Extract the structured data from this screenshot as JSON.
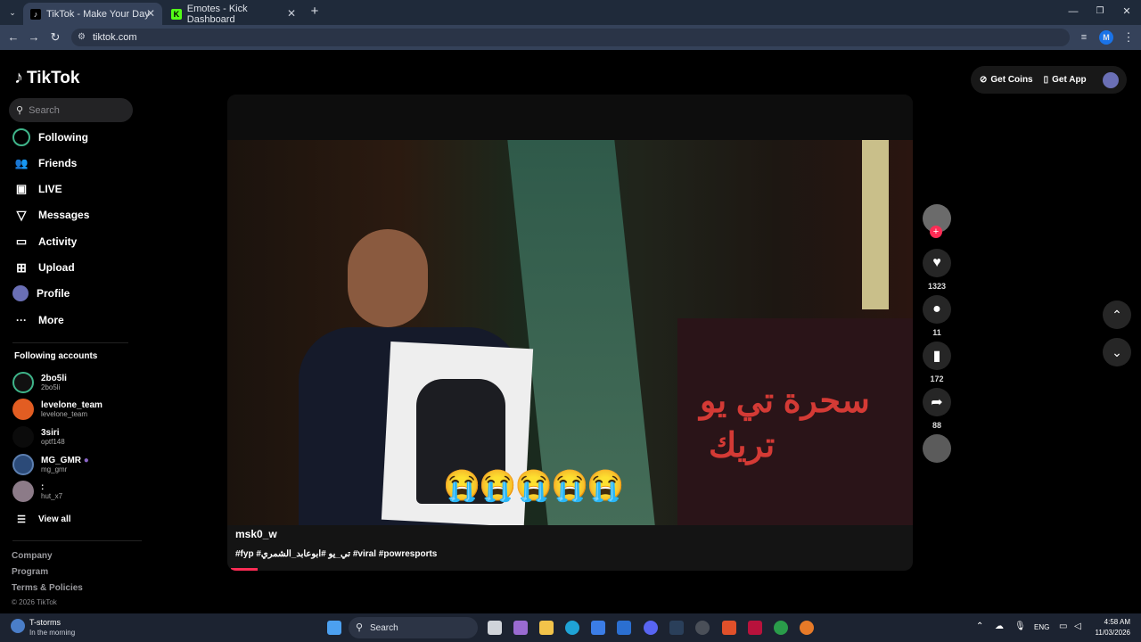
{
  "browser": {
    "tabs": [
      {
        "title": "TikTok - Make Your Day",
        "active": true
      },
      {
        "title": "Emotes - Kick Dashboard",
        "active": false
      }
    ],
    "url": "tiktok.com",
    "profile_initial": "M"
  },
  "app": {
    "brand": "TikTok",
    "search_placeholder": "Search",
    "nav": {
      "following": "Following",
      "friends": "Friends",
      "live": "LIVE",
      "messages": "Messages",
      "activity": "Activity",
      "upload": "Upload",
      "profile": "Profile",
      "more": "More"
    },
    "following_title": "Following accounts",
    "accounts": [
      {
        "name": "2bo5li",
        "handle": "2bo5li"
      },
      {
        "name": "levelone_team",
        "handle": "levelone_team"
      },
      {
        "name": "3siri",
        "handle": "optf148"
      },
      {
        "name": "MG_GMR",
        "handle": "mg_gmr"
      },
      {
        "name": ":",
        "handle": "hut_x7"
      }
    ],
    "view_all": "View all",
    "footer": {
      "company": "Company",
      "program": "Program",
      "terms": "Terms & Policies",
      "copyright": "© 2026 TikTok"
    },
    "header": {
      "get_coins": "Get Coins",
      "get_app": "Get App"
    }
  },
  "video": {
    "username": "msk0_w",
    "tags": "#fyp #تي_يو #ابوعابد_الشمري #viral #powresports",
    "overlay_text_1": "سحرة تي يو",
    "overlay_text_2": "تريك",
    "emojis": "😭😭😭😭😭",
    "progress": 0.04
  },
  "actions": {
    "likes": "1323",
    "comments": "11",
    "saves": "172",
    "shares": "88"
  },
  "taskbar": {
    "weather_title": "T-storms",
    "weather_sub": "In the morning",
    "search": "Search",
    "lang": "ENG",
    "time": "4:58 AM",
    "date": "11/03/2026"
  },
  "colors": {
    "accent": "#fe2c55",
    "chrome_bg": "#35425a",
    "tabstrip_bg": "#1f2a3a",
    "taskbar_bg": "#1c2331"
  }
}
